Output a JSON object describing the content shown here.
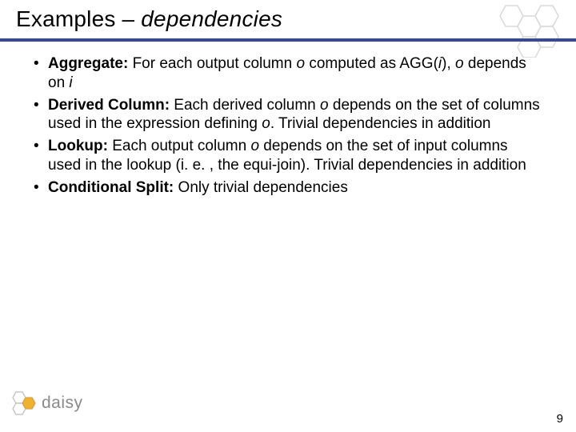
{
  "slide": {
    "title_plain": "Examples – ",
    "title_italic": "dependencies",
    "bullets": [
      {
        "label": "Aggregate:",
        "body_html": " For each output column <span class='ital'>o</span> computed as AGG(<span class='ital'>i</span>), <span class='ital'>o</span> depends on <span class='ital'>i</span>"
      },
      {
        "label": "Derived Column:",
        "body_html": " Each derived column <span class='ital'>o</span> depends on the set of columns used in the expression defining <span class='ital'>o</span>. Trivial dependencies in addition"
      },
      {
        "label": "Lookup:",
        "body_html": " Each output column <span class='ital'>o</span> depends on the set of input columns used in the lookup (i. e. , the equi-join). Trivial dependencies in addition"
      },
      {
        "label": "Conditional Split:",
        "body_html": " Only trivial dependencies"
      }
    ],
    "page_number": "9",
    "logo_text": "daisy"
  }
}
